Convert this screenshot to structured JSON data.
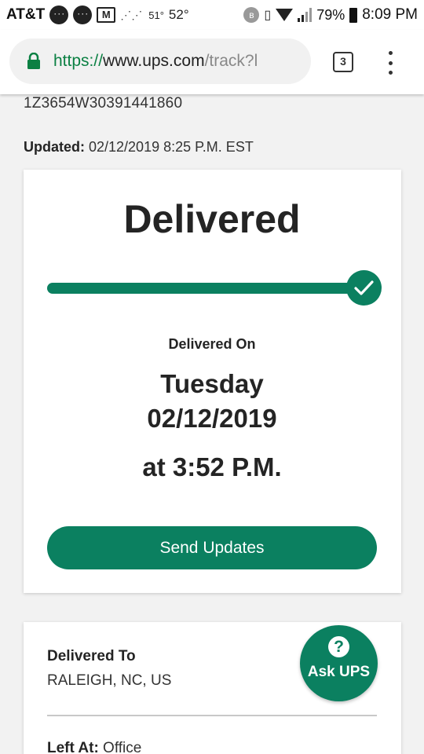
{
  "status_bar": {
    "carrier": "AT&T",
    "mail_glyph": "M",
    "temp_small": "51°",
    "temp_large": "52°",
    "bt_glyph": "ʙ",
    "vibrate_glyph": "▯",
    "battery_percent": "79%",
    "time": "8:09 PM",
    "icons": [
      "chat-bubble-icon",
      "chat-bubble-icon",
      "gmail-icon",
      "weather-icon",
      "bluetooth-icon",
      "vibrate-icon",
      "wifi-icon",
      "signal-icon",
      "battery-icon"
    ]
  },
  "browser": {
    "url_scheme": "https://",
    "url_host": "www.ups.com",
    "url_path": "/track?l",
    "tab_count": "3",
    "accent_color": "#0b8043"
  },
  "page": {
    "tracking_number": "1Z3654W30391441860",
    "updated_label": "Updated:",
    "updated_value": " 02/12/2019 8:25 P.M. EST"
  },
  "status_card": {
    "title": "Delivered",
    "progress_fraction": 1.0,
    "delivered_on_label": "Delivered On",
    "day": "Tuesday",
    "date": "02/12/2019",
    "time": "at 3:52 P.M.",
    "send_updates_label": "Send Updates",
    "brand_color": "#0b8060"
  },
  "details_card": {
    "delivered_to_label": "Delivered To",
    "delivered_to_value": "RALEIGH, NC, US",
    "left_at_label": "Left At:",
    "left_at_value": " Office"
  },
  "ask_ups": {
    "icon_glyph": "?",
    "label": "Ask UPS"
  }
}
